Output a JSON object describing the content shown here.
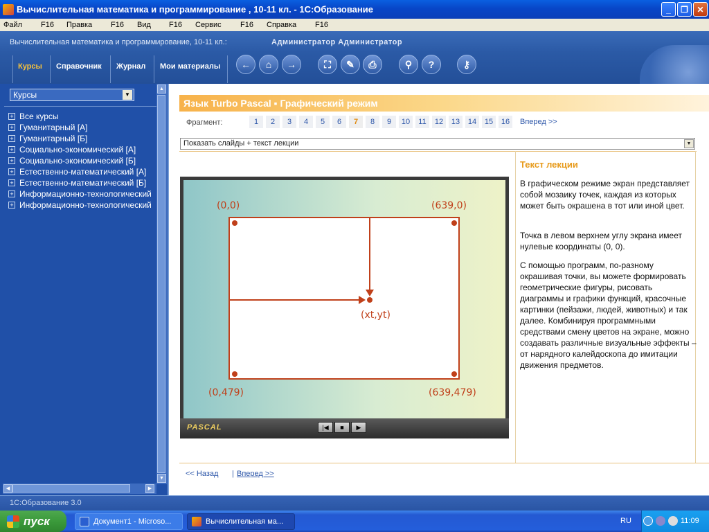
{
  "window": {
    "title": "Вычислительная математика и программирование , 10-11 кл. - 1С:Образование"
  },
  "menubar": {
    "items": [
      "Файл",
      "F16",
      "Правка",
      "F16",
      "Вид",
      "F16",
      "Сервис",
      "F16",
      "Справка",
      "F16"
    ]
  },
  "header": {
    "course": "Вычислительная математика и программирование, 10-11 кл.:",
    "user": "Администратор Администратор",
    "tabs": [
      "Курсы",
      "Справочник",
      "Журнал",
      "Мои материалы"
    ]
  },
  "sidebar": {
    "selector": "Курсы",
    "items": [
      "Все курсы",
      "Гуманитарный [А]",
      "Гуманитарный [Б]",
      "Социально-экономический [А]",
      "Социально-экономический [Б]",
      "Естественно-математический [А]",
      "Естественно-математический [Б]",
      "Информационно-технологический",
      "Информационно-технологический"
    ]
  },
  "lesson": {
    "title": "Язык Turbo Pascal ▪ Графический режим",
    "fragment_label": "Фрагмент:",
    "fragments": [
      "1",
      "2",
      "3",
      "4",
      "5",
      "6",
      "7",
      "8",
      "9",
      "10",
      "11",
      "12",
      "13",
      "14",
      "15",
      "16"
    ],
    "current_fragment": "7",
    "next_label": "Вперед >>",
    "view_mode": "Показать слайды + текст лекции",
    "back_label": "<< Назад",
    "separator": "|",
    "forward_label": "Вперед >>"
  },
  "slide": {
    "corner_tl": "(0,0)",
    "corner_tr": "(639,0)",
    "corner_bl": "(0,479)",
    "corner_br": "(639,479)",
    "point_label": "(xt,yt)",
    "brand": "PASCAL",
    "accent_color": "#c0401a"
  },
  "lecture": {
    "heading": "Текст лекции",
    "p1": "В графическом режиме экран представляет собой мозаику точек, каждая из которых может быть окрашена в тот или иной цвет.",
    "p2": "Точка в левом верхнем углу экрана имеет нулевые координаты (0, 0).",
    "p3": "С помощью программ, по-разному окрашивая точки, вы можете формировать геометрические фигуры, рисовать диаграммы и графики функций, красочные картинки (пейзажи, людей, животных) и так далее. Комбинируя программными средствами смену цветов на экране, можно создавать различные визуальные эффекты – от нарядного калейдоскопа до имитации движения предметов."
  },
  "statusbar": {
    "text": "1С:Образование 3.0"
  },
  "taskbar": {
    "start": "пуск",
    "tasks": [
      "Документ1 - Microso...",
      "Вычислительная ма..."
    ],
    "lang": "RU",
    "clock": "11:09"
  }
}
